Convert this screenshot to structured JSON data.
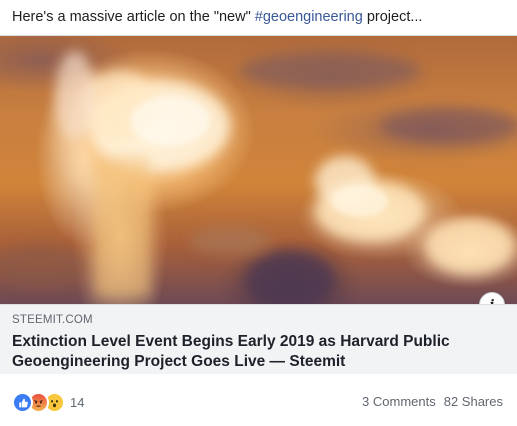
{
  "post": {
    "text_before": "Here's a massive article on the \"new\" ",
    "hashtag": "#geoengineering",
    "text_after": " project..."
  },
  "card": {
    "domain": "STEEMIT.COM",
    "headline": "Extinction Level Event Begins Early 2019 as Harvard Public Geoengineering Project Goes Live — Steemit",
    "info_icon": "info-icon",
    "info_label": "i"
  },
  "footer": {
    "reactions": [
      "like-icon",
      "angry-icon",
      "wow-icon"
    ],
    "reaction_count": "14",
    "comments": "3 Comments",
    "shares": "82 Shares"
  },
  "colors": {
    "hashtag": "#385898",
    "like": "#3b7cf5",
    "card_body": "#f2f3f5"
  }
}
